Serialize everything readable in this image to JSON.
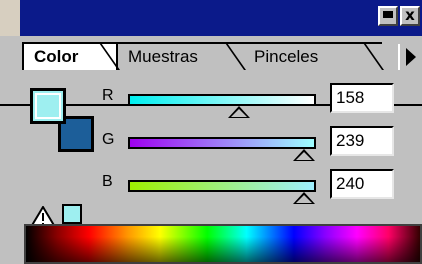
{
  "window": {
    "buttons": {
      "minimize": "minimize",
      "close": "x"
    }
  },
  "tabs": [
    {
      "label": "Color",
      "active": true
    },
    {
      "label": "Muestras",
      "active": false
    },
    {
      "label": "Pinceles",
      "active": false
    }
  ],
  "swatches": {
    "foreground_color": "#9eeff0",
    "background_color": "#1c5e99"
  },
  "sliders": [
    {
      "label": "R",
      "value": "158"
    },
    {
      "label": "G",
      "value": "239"
    },
    {
      "label": "B",
      "value": "240"
    }
  ],
  "gamut_warning": {
    "icon": "warning-triangle-icon",
    "swatch_color": "#9eeff0"
  },
  "spectrum": {
    "type": "color-ramp"
  }
}
